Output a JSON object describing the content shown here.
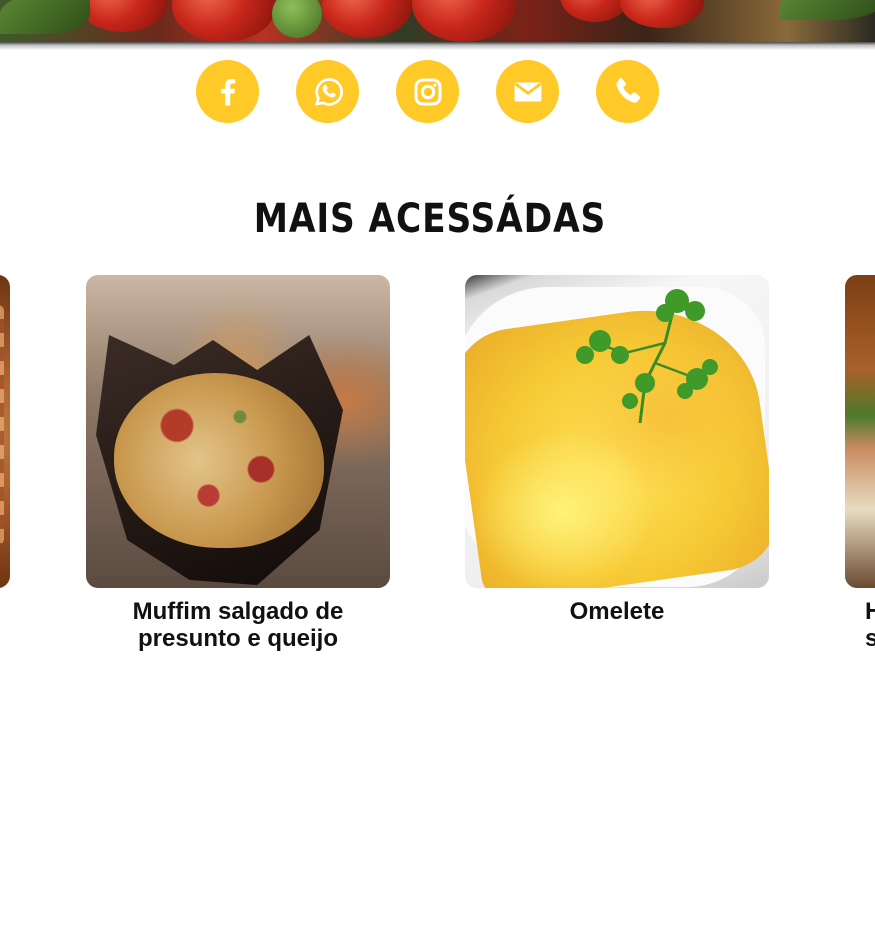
{
  "social": {
    "facebook_icon": "facebook-icon",
    "whatsapp_icon": "whatsapp-icon",
    "instagram_icon": "instagram-icon",
    "email_icon": "email-icon",
    "phone_icon": "phone-icon",
    "accent_color": "#ffc928"
  },
  "section": {
    "title": "MAIS ACESSÁDAS"
  },
  "cards": [
    {
      "caption": ""
    },
    {
      "caption": "Muffim salgado de presunto e queijo"
    },
    {
      "caption": "Omelete"
    },
    {
      "caption": "H\ns"
    }
  ]
}
